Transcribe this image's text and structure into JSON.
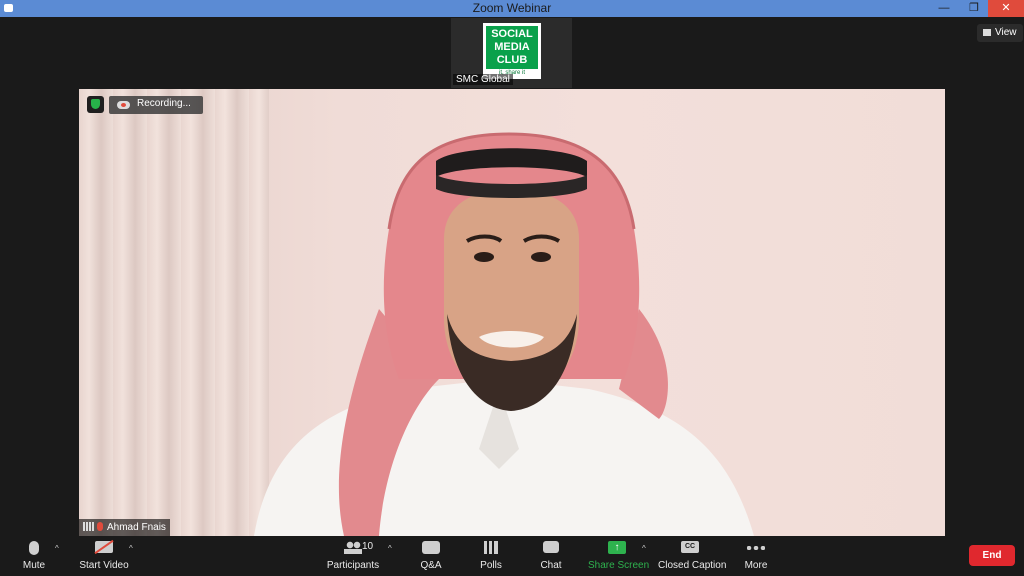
{
  "window": {
    "title": "Zoom Webinar",
    "minimize": "—",
    "maximize": "❐",
    "close": "✕"
  },
  "thumbnail": {
    "logo_lines": [
      "SOCIAL",
      "MEDIA",
      "CLUB"
    ],
    "logo_tagline": "it, share it",
    "name": "SMC Global"
  },
  "view_button": {
    "label": "View"
  },
  "video": {
    "recording_label": "Recording...",
    "speaker_name": "Ahmad Fnais"
  },
  "toolbar": {
    "mute": "Mute",
    "start_video": "Start Video",
    "participants": "Participants",
    "participants_count": "10",
    "qa": "Q&A",
    "polls": "Polls",
    "chat": "Chat",
    "share_screen": "Share Screen",
    "share_arrow": "↑",
    "closed_caption": "Closed Caption",
    "cc_glyph": "CC",
    "more": "More",
    "end": "End",
    "caret": "^"
  },
  "colors": {
    "titlebar": "#5b8bd4",
    "close": "#e04b3c",
    "share_green": "#2eb24e",
    "end_red": "#e0282e",
    "logo_green": "#0aa14b"
  }
}
